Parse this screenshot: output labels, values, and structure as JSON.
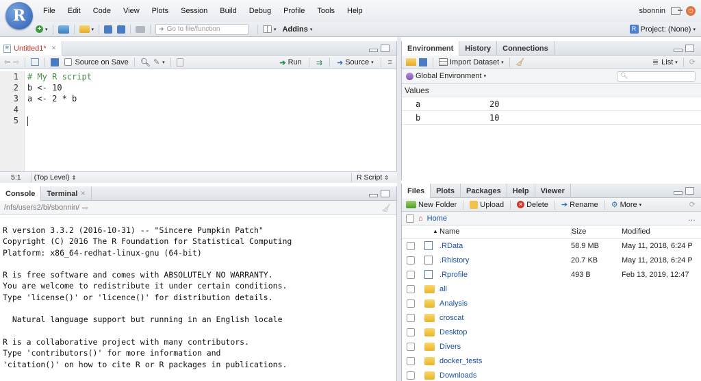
{
  "menubar": {
    "logo_letter": "R",
    "items": [
      "File",
      "Edit",
      "Code",
      "View",
      "Plots",
      "Session",
      "Build",
      "Debug",
      "Profile",
      "Tools",
      "Help"
    ],
    "user": "sbonnin"
  },
  "toolbar": {
    "goto_placeholder": "Go to file/function",
    "addins_label": "Addins",
    "project_label": "Project: (None)"
  },
  "editor": {
    "tab_label": "Untitled1*",
    "source_on_save_label": "Source on Save",
    "run_label": "Run",
    "source_label": "Source",
    "lines": [
      "# My R script",
      "b <- 10",
      "a <- 2 * b",
      "",
      ""
    ],
    "line_numbers": [
      "1",
      "2",
      "3",
      "4",
      "5"
    ],
    "status_position": "5:1",
    "status_scope": "(Top Level)",
    "status_type": "R Script"
  },
  "console": {
    "tab_console": "Console",
    "tab_terminal": "Terminal",
    "path": "/nfs/users2/bi/sbonnin/",
    "lines": [
      "R version 3.3.2 (2016-10-31) -- \"Sincere Pumpkin Patch\"",
      "Copyright (C) 2016 The R Foundation for Statistical Computing",
      "Platform: x86_64-redhat-linux-gnu (64-bit)",
      "",
      "R is free software and comes with ABSOLUTELY NO WARRANTY.",
      "You are welcome to redistribute it under certain conditions.",
      "Type 'license()' or 'licence()' for distribution details.",
      "",
      "  Natural language support but running in an English locale",
      "",
      "R is a collaborative project with many contributors.",
      "Type 'contributors()' for more information and",
      "'citation()' on how to cite R or R packages in publications."
    ]
  },
  "environment": {
    "tabs": [
      "Environment",
      "History",
      "Connections"
    ],
    "import_label": "Import Dataset",
    "list_label": "List",
    "scope_label": "Global Environment",
    "section_label": "Values",
    "values": [
      {
        "name": "a",
        "value": "20"
      },
      {
        "name": "b",
        "value": "10"
      }
    ]
  },
  "files": {
    "tabs": [
      "Files",
      "Plots",
      "Packages",
      "Help",
      "Viewer"
    ],
    "actions": {
      "new_folder": "New Folder",
      "upload": "Upload",
      "delete": "Delete",
      "rename": "Rename",
      "more": "More"
    },
    "breadcrumb_home": "Home",
    "columns": {
      "name": "Name",
      "size": "Size",
      "modified": "Modified"
    },
    "rows": [
      {
        "name": ".RData",
        "size": "58.9 MB",
        "modified": "May 11, 2018, 6:24 P",
        "icon": "rdata-icon"
      },
      {
        "name": ".Rhistory",
        "size": "20.7 KB",
        "modified": "May 11, 2018, 6:24 P",
        "icon": "rhistory-icon"
      },
      {
        "name": ".Rprofile",
        "size": "493 B",
        "modified": "Feb 13, 2019, 12:47",
        "icon": "rprofile-icon"
      },
      {
        "name": "all",
        "size": "",
        "modified": "",
        "icon": "folder-icon"
      },
      {
        "name": "Analysis",
        "size": "",
        "modified": "",
        "icon": "folder-icon"
      },
      {
        "name": "croscat",
        "size": "",
        "modified": "",
        "icon": "folder-icon"
      },
      {
        "name": "Desktop",
        "size": "",
        "modified": "",
        "icon": "folder-icon"
      },
      {
        "name": "Divers",
        "size": "",
        "modified": "",
        "icon": "folder-icon"
      },
      {
        "name": "docker_tests",
        "size": "",
        "modified": "",
        "icon": "folder-icon"
      },
      {
        "name": "Downloads",
        "size": "",
        "modified": "",
        "icon": "folder-icon"
      }
    ]
  },
  "colors": {
    "accent_blue": "#2a5db0",
    "tab_red": "#c0392b",
    "file_link": "#1a4fa0"
  }
}
